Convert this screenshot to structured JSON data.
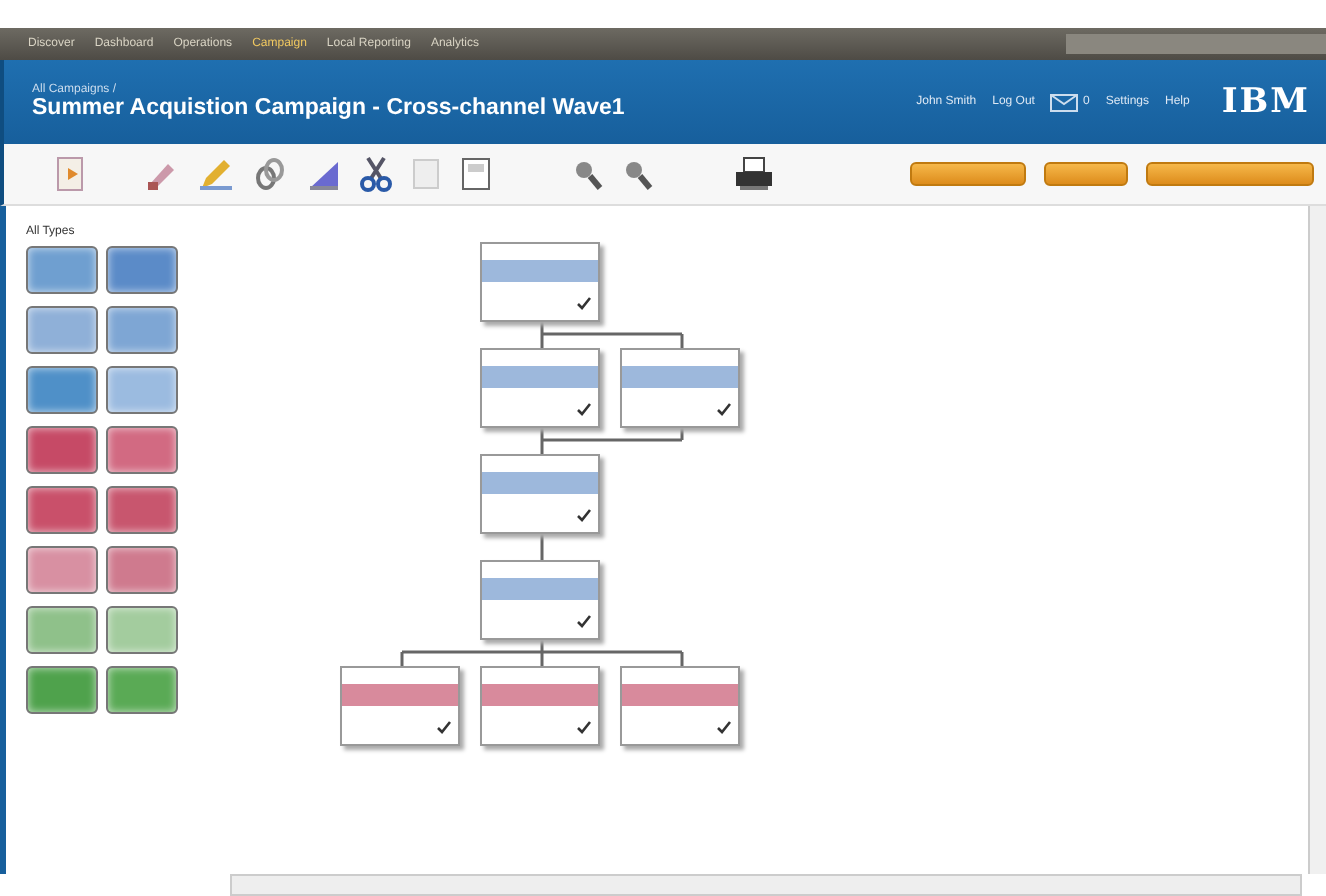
{
  "nav": [
    {
      "label": "Discover",
      "selected": false
    },
    {
      "label": "Dashboard",
      "selected": false
    },
    {
      "label": "Operations",
      "selected": false
    },
    {
      "label": "Campaign",
      "selected": true
    },
    {
      "label": "Local Reporting",
      "selected": false
    },
    {
      "label": "Analytics",
      "selected": false
    }
  ],
  "header": {
    "breadcrumb": "All Campaigns /",
    "title": "Summer Acquistion Campaign - Cross-channel Wave1",
    "links": [
      "John Smith",
      "Log Out",
      "Settings",
      "Help"
    ],
    "message_count": "0",
    "logo": "IBM"
  },
  "palette": {
    "label": "All Types",
    "items": [
      {
        "color": "#6f9fd0"
      },
      {
        "color": "#5b8bc8"
      },
      {
        "color": "#8fb0d8"
      },
      {
        "color": "#7ea6d4"
      },
      {
        "color": "#4f90c8"
      },
      {
        "color": "#9bbbe0"
      },
      {
        "color": "#c64a66"
      },
      {
        "color": "#d26a82"
      },
      {
        "color": "#c9506a"
      },
      {
        "color": "#c8566e"
      },
      {
        "color": "#d890a2"
      },
      {
        "color": "#cf7a8e"
      },
      {
        "color": "#8fc18a"
      },
      {
        "color": "#a3cc9e"
      },
      {
        "color": "#4fa24c"
      },
      {
        "color": "#5aaa55"
      }
    ]
  },
  "flowchart": {
    "rows": [
      [
        {
          "color": "#9db8dc"
        }
      ],
      [
        {
          "color": "#9db8dc"
        },
        {
          "color": "#9db8dc"
        }
      ],
      [
        {
          "color": "#9db8dc"
        }
      ],
      [
        {
          "color": "#9db8dc"
        }
      ],
      [
        {
          "color": "#d88a9c"
        },
        {
          "color": "#d88a9c"
        },
        {
          "color": "#d88a9c"
        }
      ]
    ]
  }
}
